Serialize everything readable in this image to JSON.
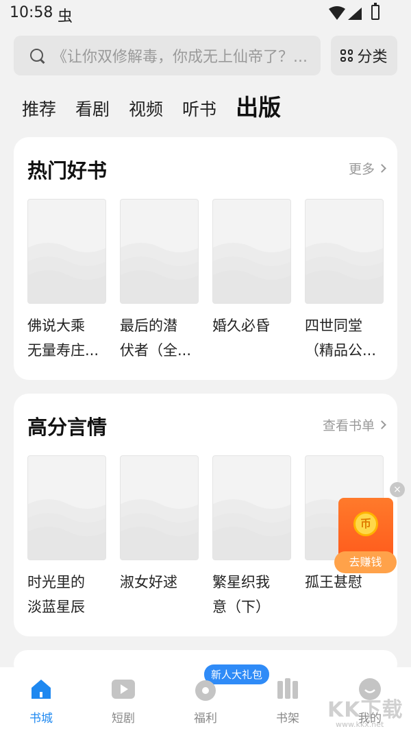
{
  "status": {
    "time": "10:58",
    "bug_icon": "虫"
  },
  "search": {
    "placeholder": "《让你双修解毒，你成无上仙帝了？..."
  },
  "category_button": {
    "label": "分类"
  },
  "tabs": [
    {
      "label": "推荐"
    },
    {
      "label": "看剧"
    },
    {
      "label": "视频"
    },
    {
      "label": "听书"
    },
    {
      "label": "出版"
    }
  ],
  "sections": [
    {
      "title": "热门好书",
      "more": "更多",
      "books": [
        {
          "line1": "佛说大乘",
          "line2": "无量寿庄..."
        },
        {
          "line1": "最后的潜",
          "line2": "伏者（全..."
        },
        {
          "line1": "婚久必昏",
          "line2": ""
        },
        {
          "line1": "四世同堂",
          "line2": "（精品公..."
        }
      ]
    },
    {
      "title": "高分言情",
      "more": "查看书单",
      "books": [
        {
          "line1": "时光里的",
          "line2": "淡蓝星辰"
        },
        {
          "line1": "淑女好逑",
          "line2": ""
        },
        {
          "line1": "繁星织我",
          "line2": "意（下）"
        },
        {
          "line1": "孤王甚慰",
          "line2": ""
        }
      ]
    }
  ],
  "earn_widget": {
    "coin": "币",
    "label": "去赚钱",
    "close": "×"
  },
  "bottom_nav": {
    "badge": "新人大礼包",
    "items": [
      {
        "label": "书城",
        "icon": "home-icon"
      },
      {
        "label": "短剧",
        "icon": "play-icon"
      },
      {
        "label": "福利",
        "icon": "gift-icon"
      },
      {
        "label": "书架",
        "icon": "bookshelf-icon"
      },
      {
        "label": "我的",
        "icon": "profile-icon"
      }
    ]
  },
  "watermark": {
    "text": "KK下载",
    "sub": "www.kkx.net"
  },
  "colors": {
    "accent": "#1e88f0",
    "earn": "#ff6a22",
    "badge": "#2f8bf7"
  }
}
